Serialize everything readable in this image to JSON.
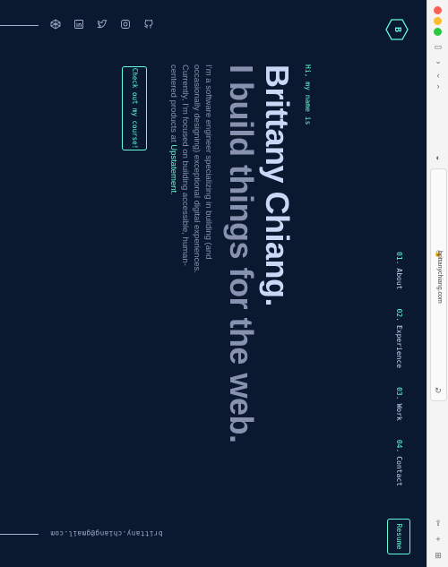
{
  "site": {
    "logo_letter": "B",
    "nav": [
      {
        "num": "01.",
        "label": "About"
      },
      {
        "num": "02.",
        "label": "Experience"
      },
      {
        "num": "03.",
        "label": "Work"
      },
      {
        "num": "04.",
        "label": "Contact"
      }
    ],
    "resume_label": "Resume",
    "hero": {
      "greeting": "Hi, my name is",
      "name": "Brittany Chiang.",
      "tagline": "I build things for the web.",
      "desc_before": "I’m a software engineer specializing in building (and occasionally designing) exceptional digital experiences. Currently, I’m focused on building accessible, human-centered products at ",
      "desc_highlight": "Upstatement",
      "desc_after": ".",
      "cta_label": "Check out my course!"
    },
    "email": "brittany.chiang@gmail.com",
    "social_icons": [
      "github-icon",
      "instagram-icon",
      "twitter-icon",
      "linkedin-icon",
      "codepen-icon"
    ]
  },
  "browser": {
    "url": "brittanychiang.com",
    "colors": {
      "red": "#ff5f57",
      "yellow": "#febc2e",
      "green": "#28c840"
    }
  },
  "colors": {
    "background": "#0a192f",
    "accent": "#64ffda",
    "heading": "#ccd6f6",
    "text": "#8892b0"
  }
}
